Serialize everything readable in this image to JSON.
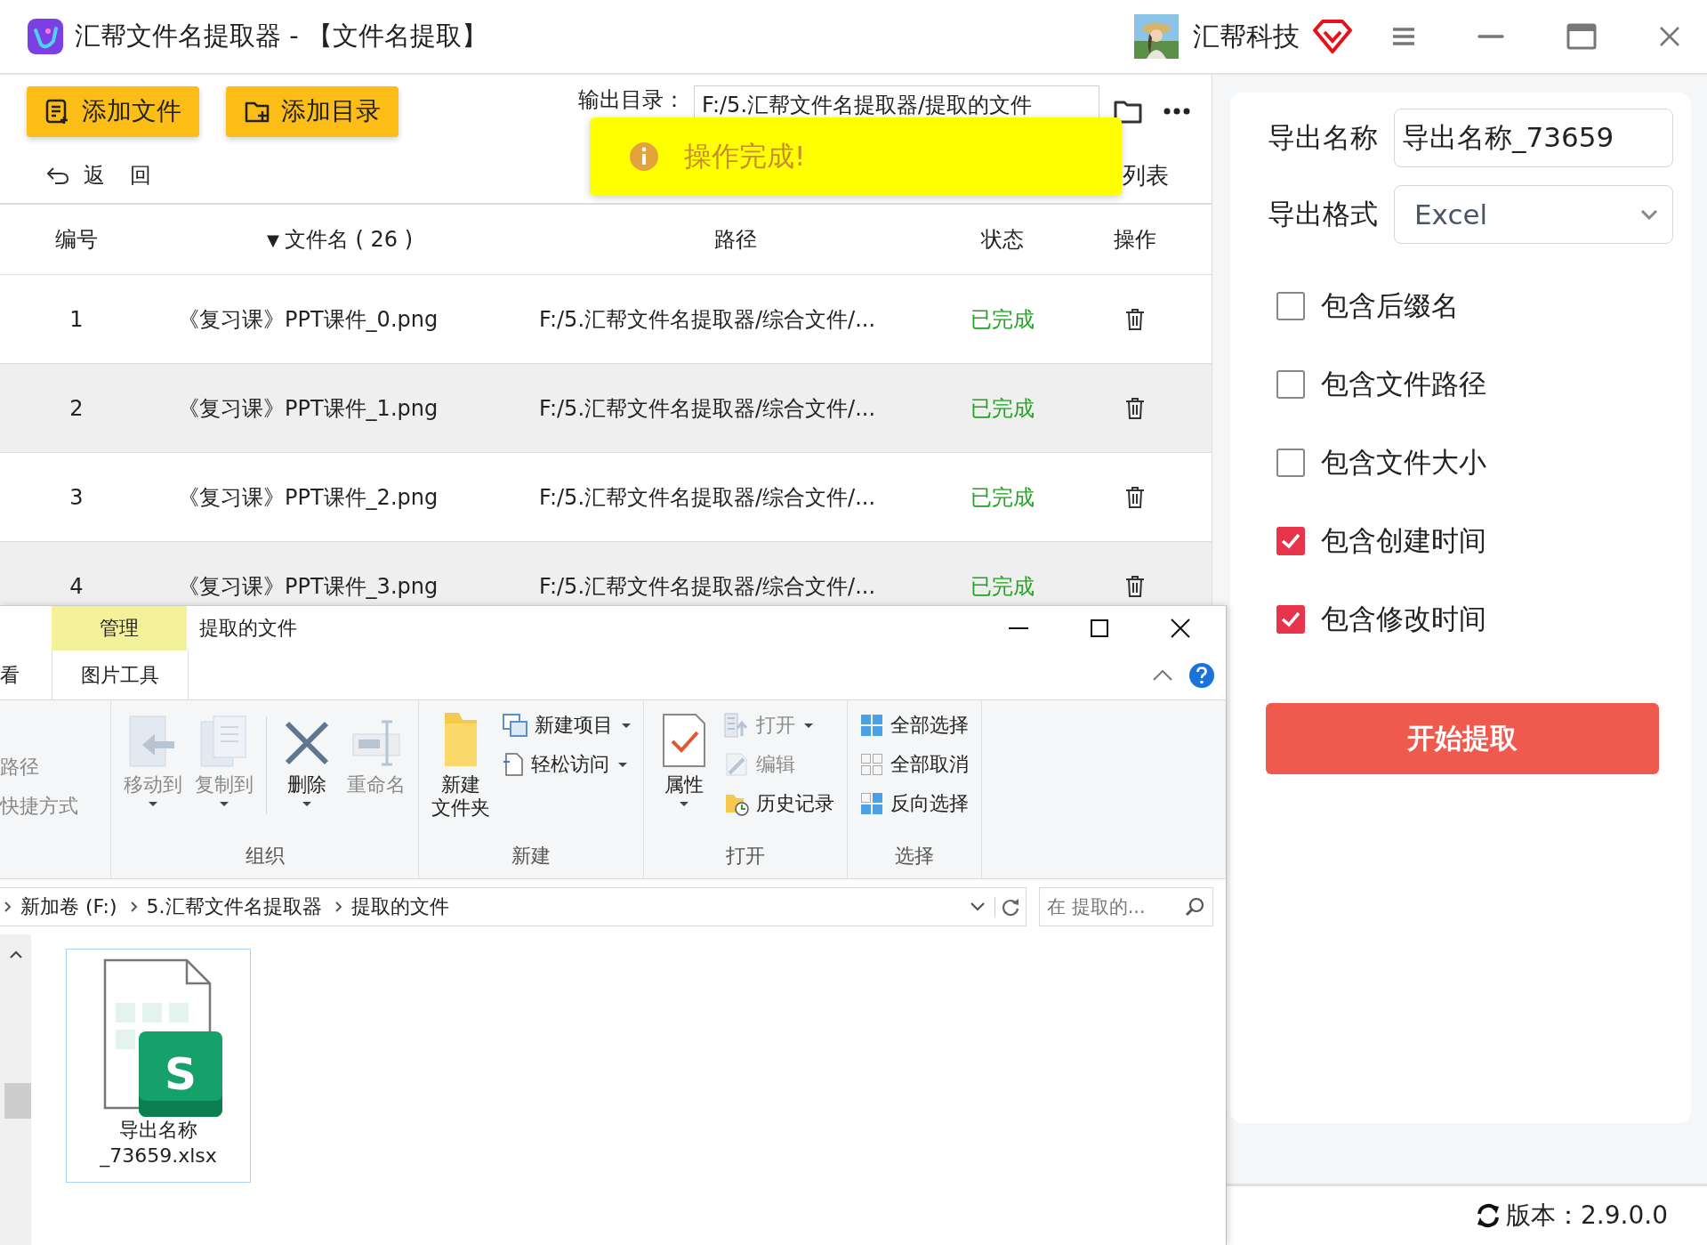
{
  "window": {
    "title": "汇帮文件名提取器 - 【文件名提取】",
    "brand": "汇帮科技"
  },
  "toolbar": {
    "buttons": [
      "添加文件",
      "添加目录"
    ],
    "output_label": "输出目录：",
    "output_path": "F:/5.汇帮文件名提取器/提取的文件"
  },
  "back_button": "返 回",
  "view_label": "列表",
  "toast": {
    "message": "操作完成!"
  },
  "table": {
    "sort_indicator": "▼",
    "columns": [
      "编号",
      "文件名 ( 26 )",
      "路径",
      "状态",
      "操作"
    ],
    "rows": [
      {
        "number": "1",
        "name": "《复习课》PPT课件_0.png",
        "path": "F:/5.汇帮文件名提取器/综合文件/...",
        "status": "已完成"
      },
      {
        "number": "2",
        "name": "《复习课》PPT课件_1.png",
        "path": "F:/5.汇帮文件名提取器/综合文件/...",
        "status": "已完成"
      },
      {
        "number": "3",
        "name": "《复习课》PPT课件_2.png",
        "path": "F:/5.汇帮文件名提取器/综合文件/...",
        "status": "已完成"
      },
      {
        "number": "4",
        "name": "《复习课》PPT课件_3.png",
        "path": "F:/5.汇帮文件名提取器/综合文件/...",
        "status": "已完成"
      }
    ]
  },
  "settings": {
    "name_label": "导出名称",
    "name_value": "导出名称_73659",
    "format_label": "导出格式",
    "format_value": "Excel",
    "options": [
      {
        "label": "包含后缀名",
        "checked": false
      },
      {
        "label": "包含文件路径",
        "checked": false
      },
      {
        "label": "包含文件大小",
        "checked": false
      },
      {
        "label": "包含创建时间",
        "checked": true
      },
      {
        "label": "包含修改时间",
        "checked": true
      }
    ],
    "start_button": "开始提取"
  },
  "version": "版本：2.9.0.0",
  "explorer": {
    "title": "提取的文件",
    "context_tab": "管理",
    "tool_tab": "图片工具",
    "cut_tab": "看",
    "ribbon": {
      "cut_items": [
        "路径",
        "快捷方式"
      ],
      "groups": [
        {
          "label": "组织",
          "items": [
            {
              "kind": "large",
              "label": "移动到",
              "disabled": true,
              "caret": true
            },
            {
              "kind": "large",
              "label": "复制到",
              "disabled": true,
              "caret": true
            },
            {
              "kind": "divider"
            },
            {
              "kind": "large",
              "label": "删除",
              "disabled": false,
              "caret": true
            },
            {
              "kind": "large",
              "label": "重命名",
              "disabled": true,
              "caret": false
            }
          ]
        },
        {
          "label": "新建",
          "items": [
            {
              "kind": "large",
              "label_lines": [
                "新建",
                "文件夹"
              ],
              "disabled": false,
              "caret": false
            },
            {
              "kind": "small",
              "label": "新建项目",
              "disabled": false,
              "caret": true
            },
            {
              "kind": "small",
              "label": "轻松访问",
              "disabled": false,
              "caret": true
            }
          ]
        },
        {
          "label": "打开",
          "items": [
            {
              "kind": "large",
              "label": "属性",
              "disabled": false,
              "caret": true
            },
            {
              "kind": "small",
              "label": "打开",
              "disabled": true,
              "caret": true
            },
            {
              "kind": "small",
              "label": "编辑",
              "disabled": true,
              "caret": false
            },
            {
              "kind": "small",
              "label": "历史记录",
              "disabled": false,
              "caret": false
            }
          ]
        },
        {
          "label": "选择",
          "items": [
            {
              "kind": "small",
              "label": "全部选择",
              "disabled": false,
              "caret": false
            },
            {
              "kind": "small",
              "label": "全部取消",
              "disabled": false,
              "caret": false
            },
            {
              "kind": "small",
              "label": "反向选择",
              "disabled": false,
              "caret": false
            }
          ]
        }
      ]
    },
    "breadcrumbs": [
      "新加卷 (F:)",
      "5.汇帮文件名提取器",
      "提取的文件"
    ],
    "search": {
      "placeholder": "在 提取的..."
    },
    "files": [
      {
        "name": "导出名称_73659.xlsx",
        "icon_letter": "S"
      }
    ]
  }
}
